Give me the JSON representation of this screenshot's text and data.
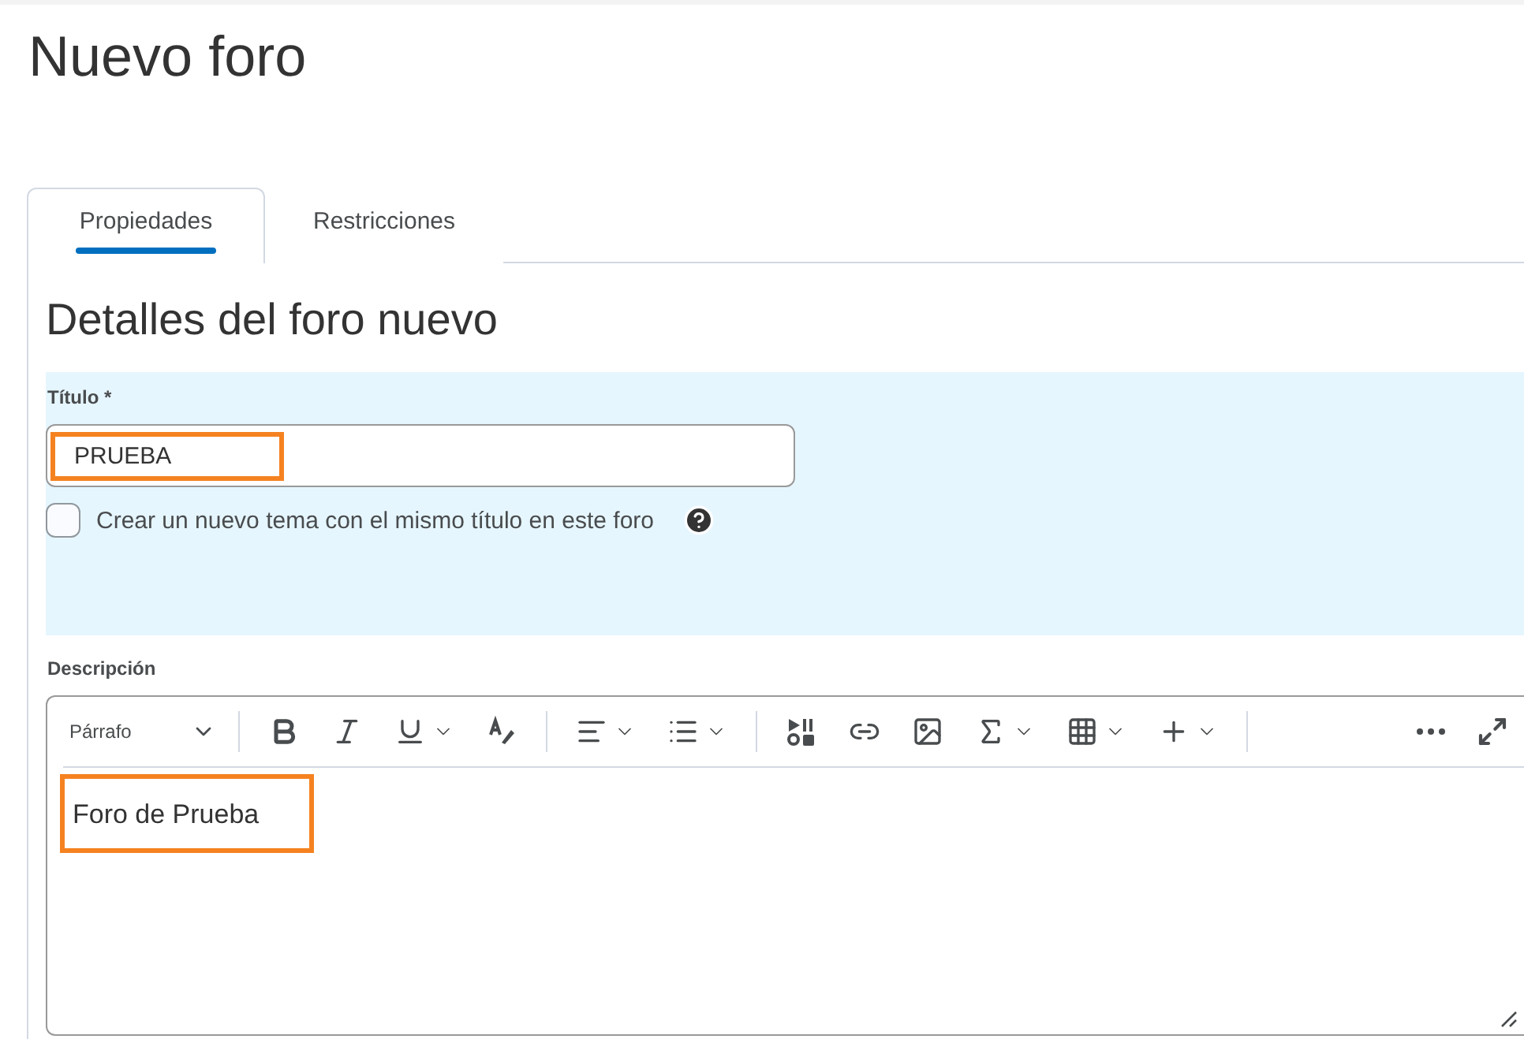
{
  "page_title": "Nuevo foro",
  "tabs": [
    {
      "label": "Propiedades",
      "selected": true
    },
    {
      "label": "Restricciones",
      "selected": false
    }
  ],
  "section_title": "Detalles del foro nuevo",
  "title_field": {
    "label": "Título *",
    "value": "PRUEBA",
    "highlighted": true
  },
  "create_topic": {
    "label": "Crear un nuevo tema con el mismo título en este foro",
    "checked": false
  },
  "description": {
    "label": "Descripción",
    "format": "Párrafo",
    "value": "Foro de Prueba",
    "highlighted": true,
    "toolbar_groups": [
      [
        {
          "kind": "bold",
          "has_menu": false
        },
        {
          "kind": "italic",
          "has_menu": false
        },
        {
          "kind": "underline",
          "has_menu": true
        },
        {
          "kind": "format",
          "has_menu": false
        }
      ],
      [
        {
          "kind": "align",
          "has_menu": true
        },
        {
          "kind": "list",
          "has_menu": true
        }
      ],
      [
        {
          "kind": "media",
          "has_menu": false
        },
        {
          "kind": "link",
          "has_menu": false
        },
        {
          "kind": "image",
          "has_menu": false
        },
        {
          "kind": "equation",
          "has_menu": true
        },
        {
          "kind": "table",
          "has_menu": true
        },
        {
          "kind": "insert",
          "has_menu": true
        }
      ]
    ]
  }
}
